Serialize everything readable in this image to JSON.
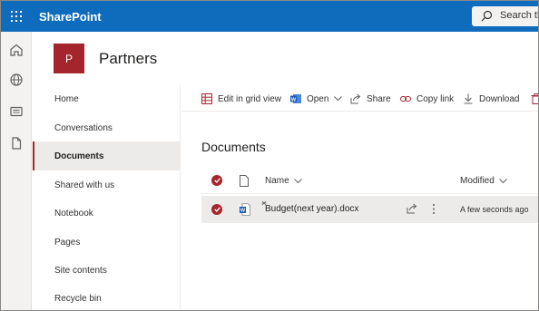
{
  "suitebar": {
    "brand": "SharePoint",
    "search_placeholder": "Search th",
    "colors": {
      "background": "#0f6cbd",
      "text": "#ffffff"
    }
  },
  "appbar": {
    "icons": [
      "home-icon",
      "globe-icon",
      "news-icon",
      "document-icon"
    ]
  },
  "site": {
    "logo_letter": "P",
    "title": "Partners",
    "logo_color": "#a4262c"
  },
  "nav": {
    "items": [
      {
        "label": "Home",
        "active": false
      },
      {
        "label": "Conversations",
        "active": false
      },
      {
        "label": "Documents",
        "active": true
      },
      {
        "label": "Shared with us",
        "active": false
      },
      {
        "label": "Notebook",
        "active": false
      },
      {
        "label": "Pages",
        "active": false
      },
      {
        "label": "Site contents",
        "active": false
      },
      {
        "label": "Recycle bin",
        "active": false
      }
    ]
  },
  "commandbar": {
    "edit_grid": "Edit in grid view",
    "open": "Open",
    "share": "Share",
    "copy_link": "Copy link",
    "download": "Download"
  },
  "library": {
    "title": "Documents",
    "columns": {
      "name": "Name",
      "modified": "Modified"
    },
    "rows": [
      {
        "name": "Budget(next year).docx",
        "modified": "A few seconds ago",
        "selected": true,
        "file_icon": "word-doc-icon"
      }
    ]
  }
}
